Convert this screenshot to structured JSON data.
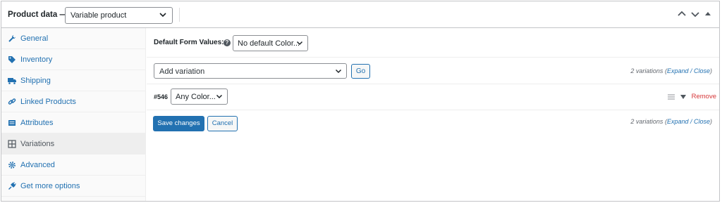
{
  "header": {
    "title": "Product data —",
    "product_type": "Variable product",
    "actions": [
      "move-up-icon",
      "move-down-icon",
      "toggle-panel-icon"
    ]
  },
  "tabs": [
    {
      "label": "General",
      "icon": "wrench-icon",
      "active": false
    },
    {
      "label": "Inventory",
      "icon": "tag-icon",
      "active": false
    },
    {
      "label": "Shipping",
      "icon": "truck-icon",
      "active": false
    },
    {
      "label": "Linked Products",
      "icon": "link-icon",
      "active": false
    },
    {
      "label": "Attributes",
      "icon": "list-icon",
      "active": false
    },
    {
      "label": "Variations",
      "icon": "grid-icon",
      "active": true
    },
    {
      "label": "Advanced",
      "icon": "gear-icon",
      "active": false
    },
    {
      "label": "Get more options",
      "icon": "plugin-icon",
      "active": false
    }
  ],
  "defaults": {
    "label": "Default Form Values:",
    "help": "?",
    "select_value": "No default Color..."
  },
  "add_variation": {
    "select_value": "Add variation",
    "go_label": "Go"
  },
  "summary": {
    "count_text": "2 variations",
    "open_paren": "(",
    "expand": "Expand",
    "sep": " / ",
    "close": "Close",
    "close_paren": ")"
  },
  "variation": {
    "id": "#546",
    "color_value": "Any Color...",
    "remove_label": "Remove"
  },
  "buttons": {
    "save_label": "Save changes",
    "cancel_label": "Cancel"
  },
  "colors": {
    "accent": "#2271b1",
    "danger": "#d63638",
    "border": "#c3c4c7",
    "tab_bg": "#fafafa",
    "tab_active_bg": "#eeeeee"
  }
}
